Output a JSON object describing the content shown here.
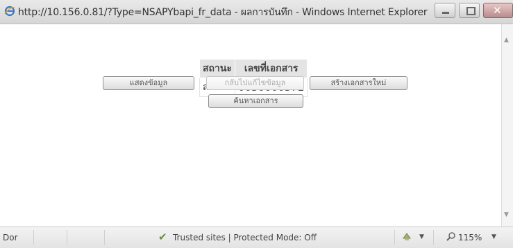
{
  "window": {
    "title": "http://10.156.0.81/?Type=NSAPYbapi_fr_data - ผลการบันทึก - Windows Internet Explorer",
    "minimize_glyph": "–",
    "maximize_glyph": "□",
    "close_glyph": "✕"
  },
  "result_table": {
    "headers": [
      "สถานะ",
      "เลขที่เอกสาร"
    ],
    "rows": [
      {
        "status": "สำเร็จ",
        "doc_number": "0030000372"
      }
    ]
  },
  "buttons": {
    "show_data": "แสดงข้อมูล",
    "back_to_edit": "กลับไปแก้ไขข้อมูล",
    "create_new_doc": "สร้างเอกสารใหม่",
    "search_doc": "ค้นหาเอกสาร"
  },
  "statusbar": {
    "left_text": "Dor",
    "zone_text": "Trusted sites | Protected Mode: Off",
    "zoom_text": "115%"
  },
  "icons": {
    "browser": "ie-icon",
    "trusted": "check-icon",
    "security": "security-icon",
    "zoom": "zoom-icon"
  }
}
